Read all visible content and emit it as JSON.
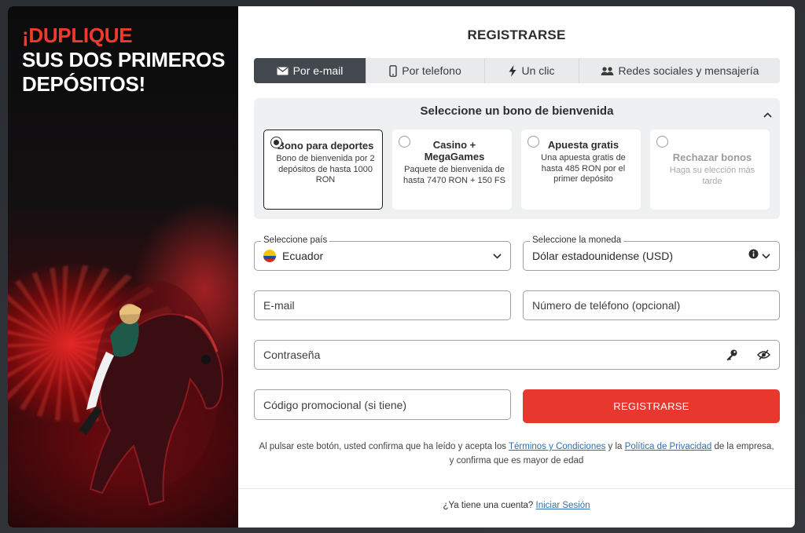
{
  "promo": {
    "line1": "¡DUPLIQUE",
    "line2": "SUS DOS PRIMEROS",
    "line3": "DEPÓSITOS!"
  },
  "title": "REGISTRARSE",
  "tabs": [
    {
      "label": "Por e-mail",
      "icon": "envelope-icon",
      "active": true
    },
    {
      "label": "Por telefono",
      "icon": "phone-icon",
      "active": false
    },
    {
      "label": "Un clic",
      "icon": "lightning-icon",
      "active": false
    },
    {
      "label": "Redes sociales y mensajería",
      "icon": "people-icon",
      "active": false
    }
  ],
  "bonus": {
    "heading": "Seleccione un bono de bienvenida",
    "cards": [
      {
        "title": "Bono para deportes",
        "desc": "Bono de bienvenida por 2 depósitos de hasta 1000 RON",
        "selected": true
      },
      {
        "title": "Casino + MegaGames",
        "desc": "Paquete de bienvenida de hasta 7470 RON + 150 FS",
        "selected": false
      },
      {
        "title": "Apuesta gratis",
        "desc": "Una apuesta gratis de hasta 485 RON por el primer depósito",
        "selected": false
      },
      {
        "title": "Rechazar bonos",
        "desc": "Haga su elección más tarde",
        "selected": false
      }
    ]
  },
  "form": {
    "country_label": "Seleccione país",
    "country_value": "Ecuador",
    "currency_label": "Seleccione la moneda",
    "currency_value": "Dólar estadounidense (USD)",
    "email_placeholder": "E-mail",
    "phone_placeholder": "Número de teléfono (opcional)",
    "password_placeholder": "Contraseña",
    "promo_placeholder": "Código promocional (si tiene)",
    "submit_label": "REGISTRARSE"
  },
  "terms": {
    "part1": "Al pulsar este botón, usted confirma que ha leído y acepta los ",
    "link1": "Términos y Condiciones",
    "part2": " y la ",
    "link2": "Política de Privacidad",
    "part3": " de la empresa,",
    "line2": "y confirma que es mayor de edad"
  },
  "footer": {
    "question": "¿Ya tiene una cuenta? ",
    "login_link": "Iniciar Sesión"
  },
  "colors": {
    "accent": "#e8372d",
    "promo_red": "#f03a2c",
    "tab_active": "#43474e",
    "link": "#2f6fb0"
  }
}
